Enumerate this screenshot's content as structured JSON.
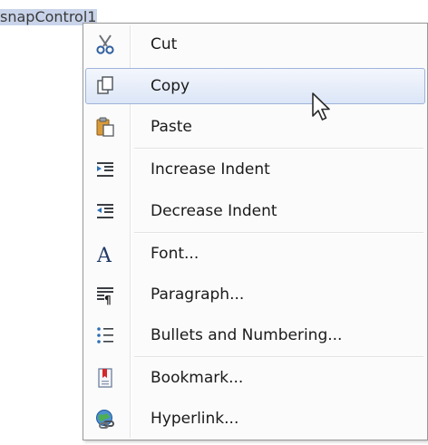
{
  "control": {
    "name": "snapControl1"
  },
  "context_menu": {
    "items": [
      {
        "label": "Cut",
        "icon": "scissors-icon"
      },
      {
        "label": "Copy",
        "icon": "copy-icon",
        "highlighted": true
      },
      {
        "label": "Paste",
        "icon": "paste-icon"
      },
      {
        "label": "Increase Indent",
        "icon": "increase-indent-icon"
      },
      {
        "label": "Decrease Indent",
        "icon": "decrease-indent-icon"
      },
      {
        "label": "Font...",
        "icon": "font-icon"
      },
      {
        "label": "Paragraph...",
        "icon": "paragraph-icon"
      },
      {
        "label": "Bullets and Numbering...",
        "icon": "bullets-icon"
      },
      {
        "label": "Bookmark...",
        "icon": "bookmark-icon"
      },
      {
        "label": "Hyperlink...",
        "icon": "hyperlink-icon"
      }
    ]
  },
  "colors": {
    "highlight_border": "#9fb3d9",
    "highlight_fill": "#dce6f7",
    "selection_background": "#c9d4ea",
    "menu_border": "#979797"
  }
}
